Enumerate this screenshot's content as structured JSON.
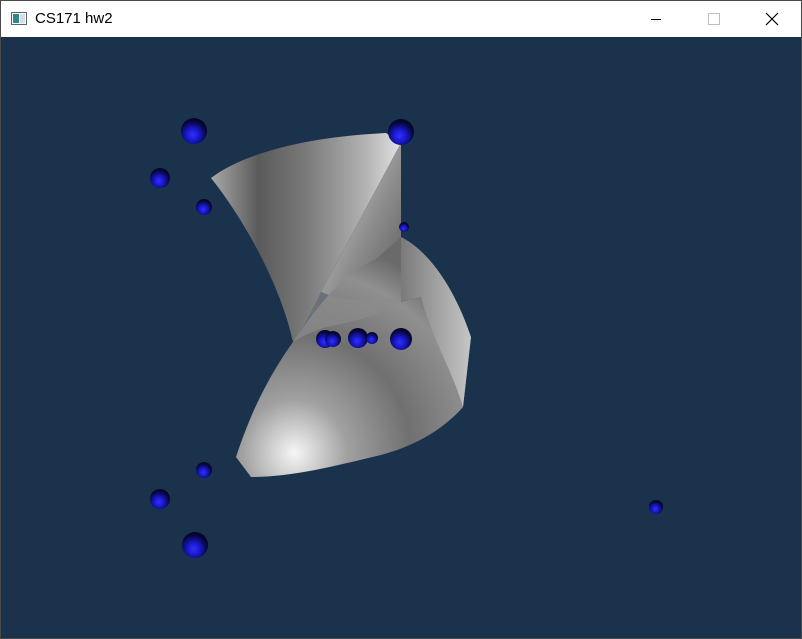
{
  "window": {
    "title": "CS171 hw2",
    "controls": [
      "minimize-icon",
      "maximize-icon",
      "close-icon"
    ]
  },
  "viewport": {
    "background_color": "#1b324d",
    "surface_color": "#9a9a9a",
    "control_point_color": "#1010e0"
  }
}
